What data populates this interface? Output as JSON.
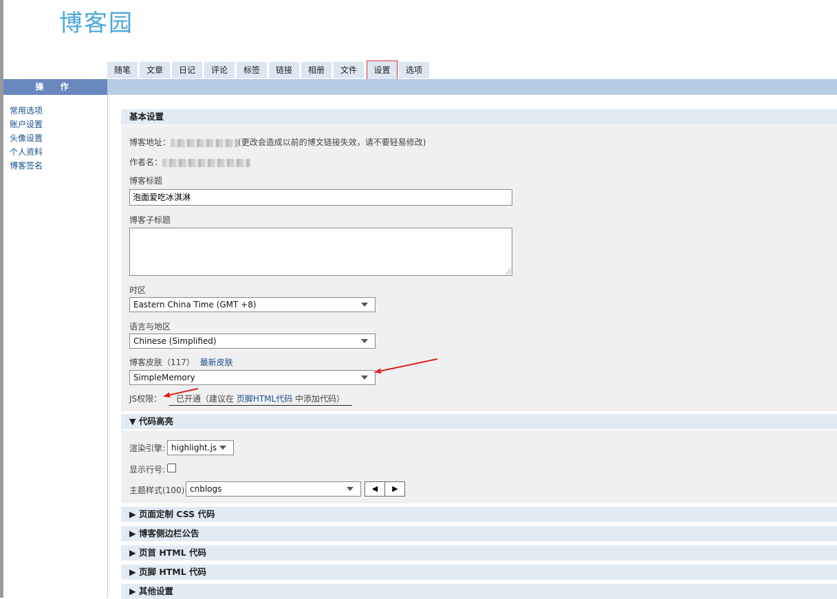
{
  "brand": {
    "logo_text": "博客园"
  },
  "tabs": [
    {
      "label": "随笔"
    },
    {
      "label": "文章"
    },
    {
      "label": "日记"
    },
    {
      "label": "评论"
    },
    {
      "label": "标签"
    },
    {
      "label": "链接"
    },
    {
      "label": "相册"
    },
    {
      "label": "文件"
    },
    {
      "label": "设置",
      "active": true
    },
    {
      "label": "选项"
    }
  ],
  "sidebar": {
    "header": "操 作",
    "items": [
      {
        "label": "常用选项"
      },
      {
        "label": "账户设置"
      },
      {
        "label": "头像设置"
      },
      {
        "label": "个人资料"
      },
      {
        "label": "博客签名"
      }
    ]
  },
  "basic": {
    "header": "基本设置",
    "blog_url_label": "博客地址：",
    "blog_url_note": "(更改会造成以前的博文链接失效，请不要轻易修改)",
    "author_label": "作者名：",
    "title_label": "博客标题",
    "title_value": "泡面爱吃冰淇淋",
    "subtitle_label": "博客子标题",
    "subtitle_value": "",
    "timezone_label": "时区",
    "timezone_value": "Eastern China Time (GMT +8)",
    "locale_label": "语言与地区",
    "locale_value": "Chinese (Simplified)",
    "skin_label": "博客皮肤（117）",
    "skin_link": "最新皮肤",
    "skin_value": "SimpleMemory",
    "js_label": "JS权限：",
    "js_status_prefix": "已开通（建议在 ",
    "js_status_link": "页脚HTML代码",
    "js_status_suffix": " 中添加代码）"
  },
  "code": {
    "header": "▼ 代码高亮",
    "engine_label": "渲染引擎:",
    "engine_value": "highlight.js",
    "line_numbers_label": "显示行号:",
    "line_numbers_checked": false,
    "theme_label": "主题样式(100):",
    "theme_value": "cnblogs",
    "prev_icon": "◀",
    "next_icon": "▶"
  },
  "collapsed_sections": [
    {
      "label": "▶ 页面定制 CSS 代码"
    },
    {
      "label": "▶ 博客侧边栏公告"
    },
    {
      "label": "▶ 页首 HTML 代码"
    },
    {
      "label": "▶ 页脚 HTML 代码"
    },
    {
      "label": "▶ 其他设置"
    }
  ],
  "colors": {
    "accent": "#e03030",
    "link": "#1a4f8a",
    "sidebar_head": "#6888be",
    "bar": "#b7cbe5"
  }
}
